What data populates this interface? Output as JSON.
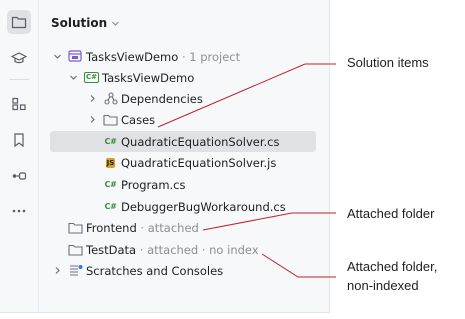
{
  "activity_bar": {
    "items": [
      {
        "icon": "folder-icon",
        "active": true
      },
      {
        "icon": "graduation-cap-icon"
      },
      {
        "icon": "structure-icon"
      },
      {
        "icon": "bookmark-icon"
      },
      {
        "icon": "services-icon"
      },
      {
        "icon": "more-icon"
      }
    ]
  },
  "panel": {
    "title": "Solution"
  },
  "tree": {
    "solution": {
      "label": "TasksViewDemo",
      "hint": "· 1 project"
    },
    "project": {
      "label": "TasksViewDemo"
    },
    "dependencies": {
      "label": "Dependencies"
    },
    "cases": {
      "label": "Cases"
    },
    "file_quadratic_cs": {
      "label": "QuadraticEquationSolver.cs"
    },
    "file_quadratic_js": {
      "label": "QuadraticEquationSolver.js"
    },
    "file_program": {
      "label": "Program.cs"
    },
    "file_debugger": {
      "label": "DebuggerBugWorkaround.cs"
    },
    "frontend": {
      "label": "Frontend",
      "hint": "· attached"
    },
    "testdata": {
      "label": "TestData",
      "hint": "· attached · no index"
    },
    "scratches": {
      "label": "Scratches and Consoles"
    }
  },
  "badges": {
    "cs": "C#",
    "js": "JS"
  },
  "annotations": {
    "solution_items": "Solution items",
    "attached_folder": "Attached folder",
    "attached_nonindexed_line1": "Attached folder,",
    "attached_nonindexed_line2": "non-indexed"
  },
  "colors": {
    "annotation_line": "#c0202a",
    "selection": "#dfe1e5",
    "csharp": "#3f8b3f",
    "js": "#d8a323"
  }
}
